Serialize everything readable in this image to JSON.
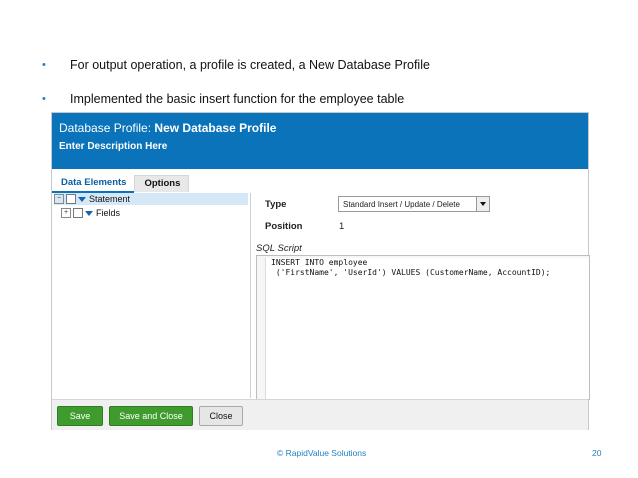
{
  "bullets": [
    "For output operation, a profile is created, a New Database Profile",
    "Implemented the basic insert function for the employee table"
  ],
  "header": {
    "title_prefix": "Database Profile:",
    "title_name": "New Database Profile",
    "description": "Enter Description Here",
    "color": "#0a73ba"
  },
  "tabs": [
    "Data Elements",
    "Options"
  ],
  "tree": {
    "statement": "Statement",
    "fields": "Fields"
  },
  "form": {
    "type_label": "Type",
    "type_value": "Standard Insert / Update / Delete",
    "position_label": "Position",
    "position_value": "1",
    "sql_label": "SQL Script",
    "sql_lines": [
      "INSERT INTO employee",
      " ('FirstName', 'UserId') VALUES (CustomerName, AccountID);"
    ]
  },
  "buttons": {
    "save": "Save",
    "save_close": "Save and Close",
    "close": "Close"
  },
  "footer": {
    "copyright": "© RapidValue Solutions",
    "page_number": "20"
  }
}
